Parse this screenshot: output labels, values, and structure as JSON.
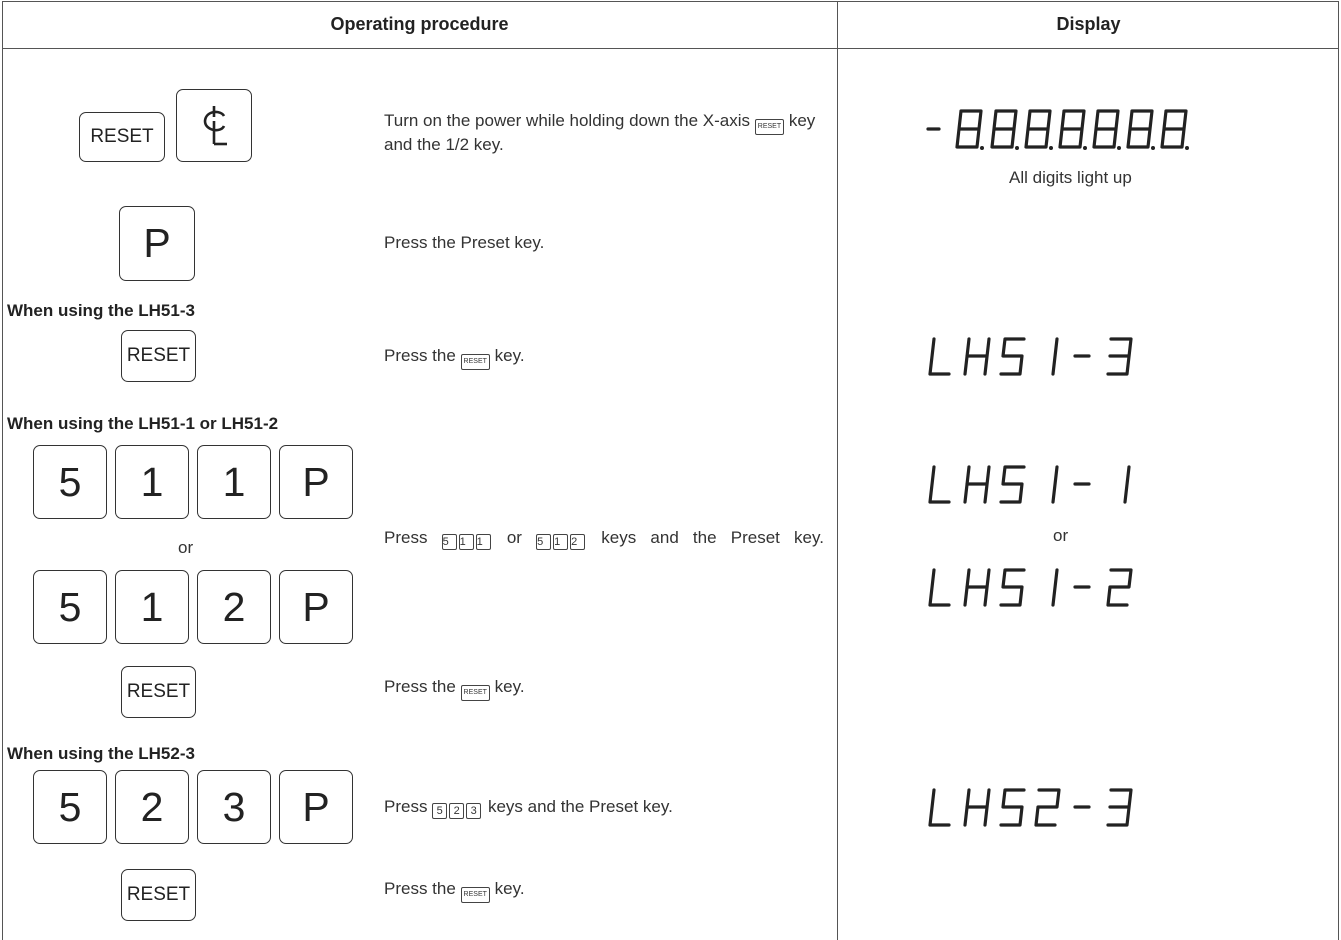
{
  "headers": {
    "procedure": "Operating procedure",
    "display": "Display"
  },
  "keys": {
    "reset": "RESET",
    "half": "½",
    "preset": "P",
    "d5": "5",
    "d1": "1",
    "d2": "2",
    "d3": "3"
  },
  "steps": {
    "power_on": {
      "text_a": "Turn on the power while holding down the X-axis",
      "text_b": "key and the 1/2 key."
    },
    "preset": {
      "text": "Press the Preset key."
    },
    "press_reset": {
      "text_a": "Press the",
      "text_b": "key."
    },
    "keys_51": {
      "text_a": "Press",
      "text_or": "or",
      "text_b": "keys and the Preset key."
    },
    "keys_52": {
      "text_a": "Press",
      "text_b": "keys and the Preset key."
    }
  },
  "sections": {
    "lh51_3": "When using the LH51-3",
    "lh51_12": "When using the LH51-1 or LH51-2",
    "lh52_3": "When using the LH52-3"
  },
  "or": "or",
  "display": {
    "all_digits": "-8.8.8.8.8.8.8.",
    "all_digits_caption": "All digits light up",
    "lh51_3": "LH51-3",
    "lh51_1": "LH51-1",
    "lh51_2": "LH51-2",
    "lh52_3": "LH52-3",
    "or": "or"
  }
}
